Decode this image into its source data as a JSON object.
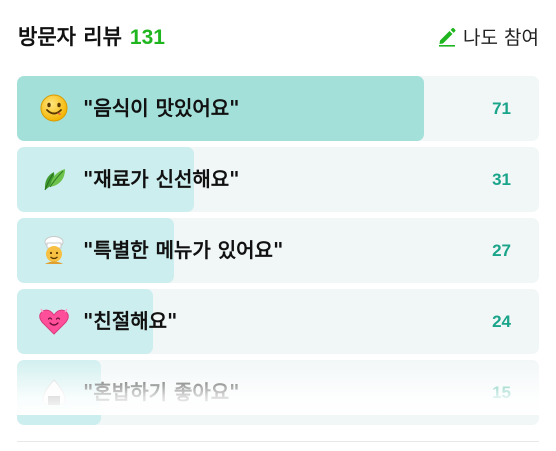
{
  "header": {
    "title": "방문자 리뷰",
    "count": "131",
    "join_label": "나도 참여"
  },
  "colors": {
    "accent_green": "#1fb51f",
    "value_teal": "#1aa58a",
    "top_fill": "#a3e0d9",
    "fill": "#cdeeee",
    "row_bg": "#f1f6f7"
  },
  "reviews": [
    {
      "icon": "smiling-face-icon",
      "label": "\"음식이 맛있어요\"",
      "value": "71",
      "fill_fraction": 0.78
    },
    {
      "icon": "leaf-icon",
      "label": "\"재료가 신선해요\"",
      "value": "31",
      "fill_fraction": 0.34
    },
    {
      "icon": "chef-icon",
      "label": "\"특별한 메뉴가 있어요\"",
      "value": "27",
      "fill_fraction": 0.3
    },
    {
      "icon": "heart-face-icon",
      "label": "\"친절해요\"",
      "value": "24",
      "fill_fraction": 0.26
    },
    {
      "icon": "rice-ball-icon",
      "label": "\"혼밥하기 좋아요\"",
      "value": "15",
      "fill_fraction": 0.16
    }
  ]
}
